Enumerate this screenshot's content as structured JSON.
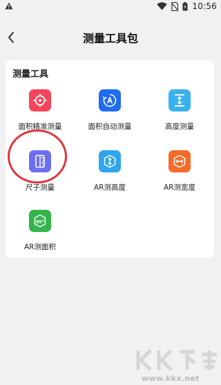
{
  "status_bar": {
    "time": "10:56",
    "icons": [
      "warning-icon",
      "wifi-icon",
      "no-sim-icon",
      "battery-icon"
    ]
  },
  "nav": {
    "back_icon": "chevron-left-icon",
    "title": "测量工具包"
  },
  "section": {
    "title": "测量工具"
  },
  "tools": [
    {
      "label": "面积精准测量",
      "icon": "target-icon",
      "color": "#f2455c"
    },
    {
      "label": "面积自动测量",
      "icon": "auto-measure-icon",
      "color": "#1e6cf0"
    },
    {
      "label": "高度测量",
      "icon": "height-icon",
      "color": "#39b1ee"
    },
    {
      "label": "尺子测量",
      "icon": "ruler-icon",
      "color": "#6c6ef0"
    },
    {
      "label": "AR测高度",
      "icon": "ar-height-icon",
      "color": "#2fa6ee"
    },
    {
      "label": "AR测宽度",
      "icon": "ar-width-icon",
      "color": "#f46b2a"
    },
    {
      "label": "AR测面积",
      "icon": "ar-area-icon",
      "color": "#33b44a"
    }
  ],
  "highlight": {
    "color": "#e0343a"
  },
  "watermark": {
    "url": "www.kkx.net"
  }
}
